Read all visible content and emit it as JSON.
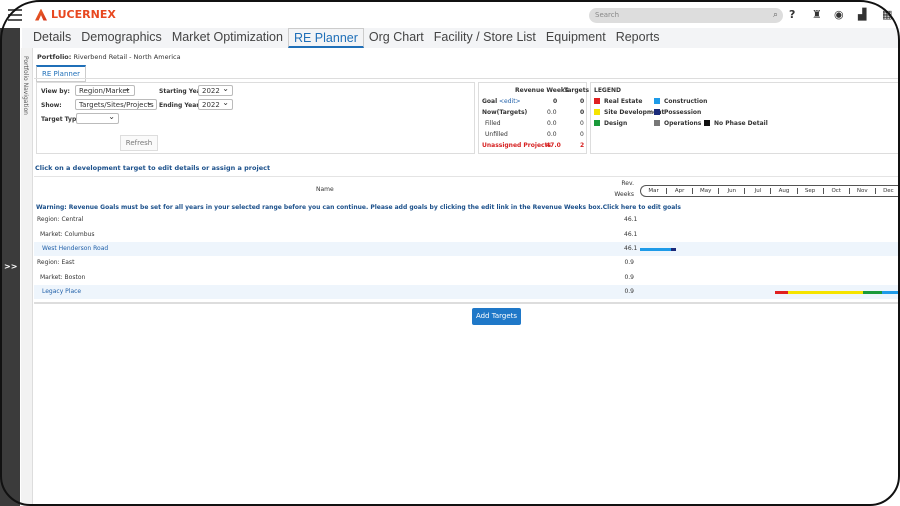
{
  "app": {
    "logo": "LUCERNEX",
    "search_placeholder": "Search"
  },
  "tabs": [
    "Details",
    "Demographics",
    "Market Optimization",
    "RE Planner",
    "Org Chart",
    "Facility / Store List",
    "Equipment",
    "Reports"
  ],
  "active_tab": "RE Planner",
  "sidebar": {
    "expand": ">>",
    "portfolio_nav": "Portfolio Navigation"
  },
  "portfolio": {
    "label": "Portfolio:",
    "value": "Riverbend Retail - North America"
  },
  "subtab": "RE Planner",
  "filters": {
    "view_by_label": "View by:",
    "view_by": "Region/Market",
    "show_label": "Show:",
    "show": "Targets/Sites/Projects",
    "target_type_label": "Target Type:",
    "target_type": "",
    "starting_year_label": "Starting Year:",
    "starting_year": "2022",
    "ending_year_label": "Ending Year:",
    "ending_year": "2022",
    "refresh": "Refresh"
  },
  "revenue": {
    "col1": "Revenue Weeks",
    "col2": "Targets",
    "rows": [
      {
        "label": "Goal",
        "edit": "<edit>",
        "weeks": "0",
        "targets": "0"
      },
      {
        "label": "Now(Targets)",
        "weeks": "0.0",
        "targets": "0"
      },
      {
        "label": "Filled",
        "weeks": "0.0",
        "targets": "0"
      },
      {
        "label": "Unfilled",
        "weeks": "0.0",
        "targets": "0"
      },
      {
        "label": "Unassigned Projects",
        "weeks": "47.0",
        "targets": "2"
      }
    ]
  },
  "legend": {
    "title": "LEGEND",
    "items": [
      {
        "label": "Real Estate",
        "color": "#e02020"
      },
      {
        "label": "Construction",
        "color": "#1e9be8"
      },
      {
        "label": "Site Development",
        "color": "#f5e400"
      },
      {
        "label": "Possession",
        "color": "#1a2a7a"
      },
      {
        "label": "Design",
        "color": "#1a9a3a"
      },
      {
        "label": "Operations",
        "color": "#777777"
      },
      {
        "label": "No Phase Detail",
        "color": "#111111"
      }
    ]
  },
  "instruction": "Click on a development target to edit details or assign a project",
  "table": {
    "name_header": "Name",
    "rev_header_1": "Rev.",
    "rev_header_2": "Weeks",
    "months": [
      "Mar",
      "Apr",
      "May",
      "Jun",
      "Jul",
      "Aug",
      "Sep",
      "Oct",
      "Nov",
      "Dec"
    ],
    "warning": "Warning: Revenue Goals must be set for all years in your selected range before you can continue. Please add goals by clicking the edit link in the Revenue Weeks box.",
    "warning_link": "Click here to edit goals",
    "rows": [
      {
        "name": "Region: Central",
        "weeks": "46.1"
      },
      {
        "name": "Market: Columbus",
        "weeks": "46.1"
      },
      {
        "name": "West Henderson Road",
        "weeks": "46.1",
        "phases": [
          {
            "phase": "Construction",
            "start": 0,
            "end": 1.15
          },
          {
            "phase": "Possession",
            "start": 1.15,
            "end": 1.36
          }
        ]
      },
      {
        "name": "Region: East",
        "weeks": "0.9"
      },
      {
        "name": "Market: Boston",
        "weeks": "0.9"
      },
      {
        "name": "Legacy Place",
        "weeks": "0.9",
        "phases": [
          {
            "phase": "Real Estate",
            "start": 5.08,
            "end": 5.56
          },
          {
            "phase": "Site Development",
            "start": 5.56,
            "end": 8.38
          },
          {
            "phase": "Design",
            "start": 8.38,
            "end": 9.1
          },
          {
            "phase": "Construction",
            "start": 9.1,
            "end": 10
          }
        ]
      }
    ]
  },
  "add_targets": "Add Targets"
}
